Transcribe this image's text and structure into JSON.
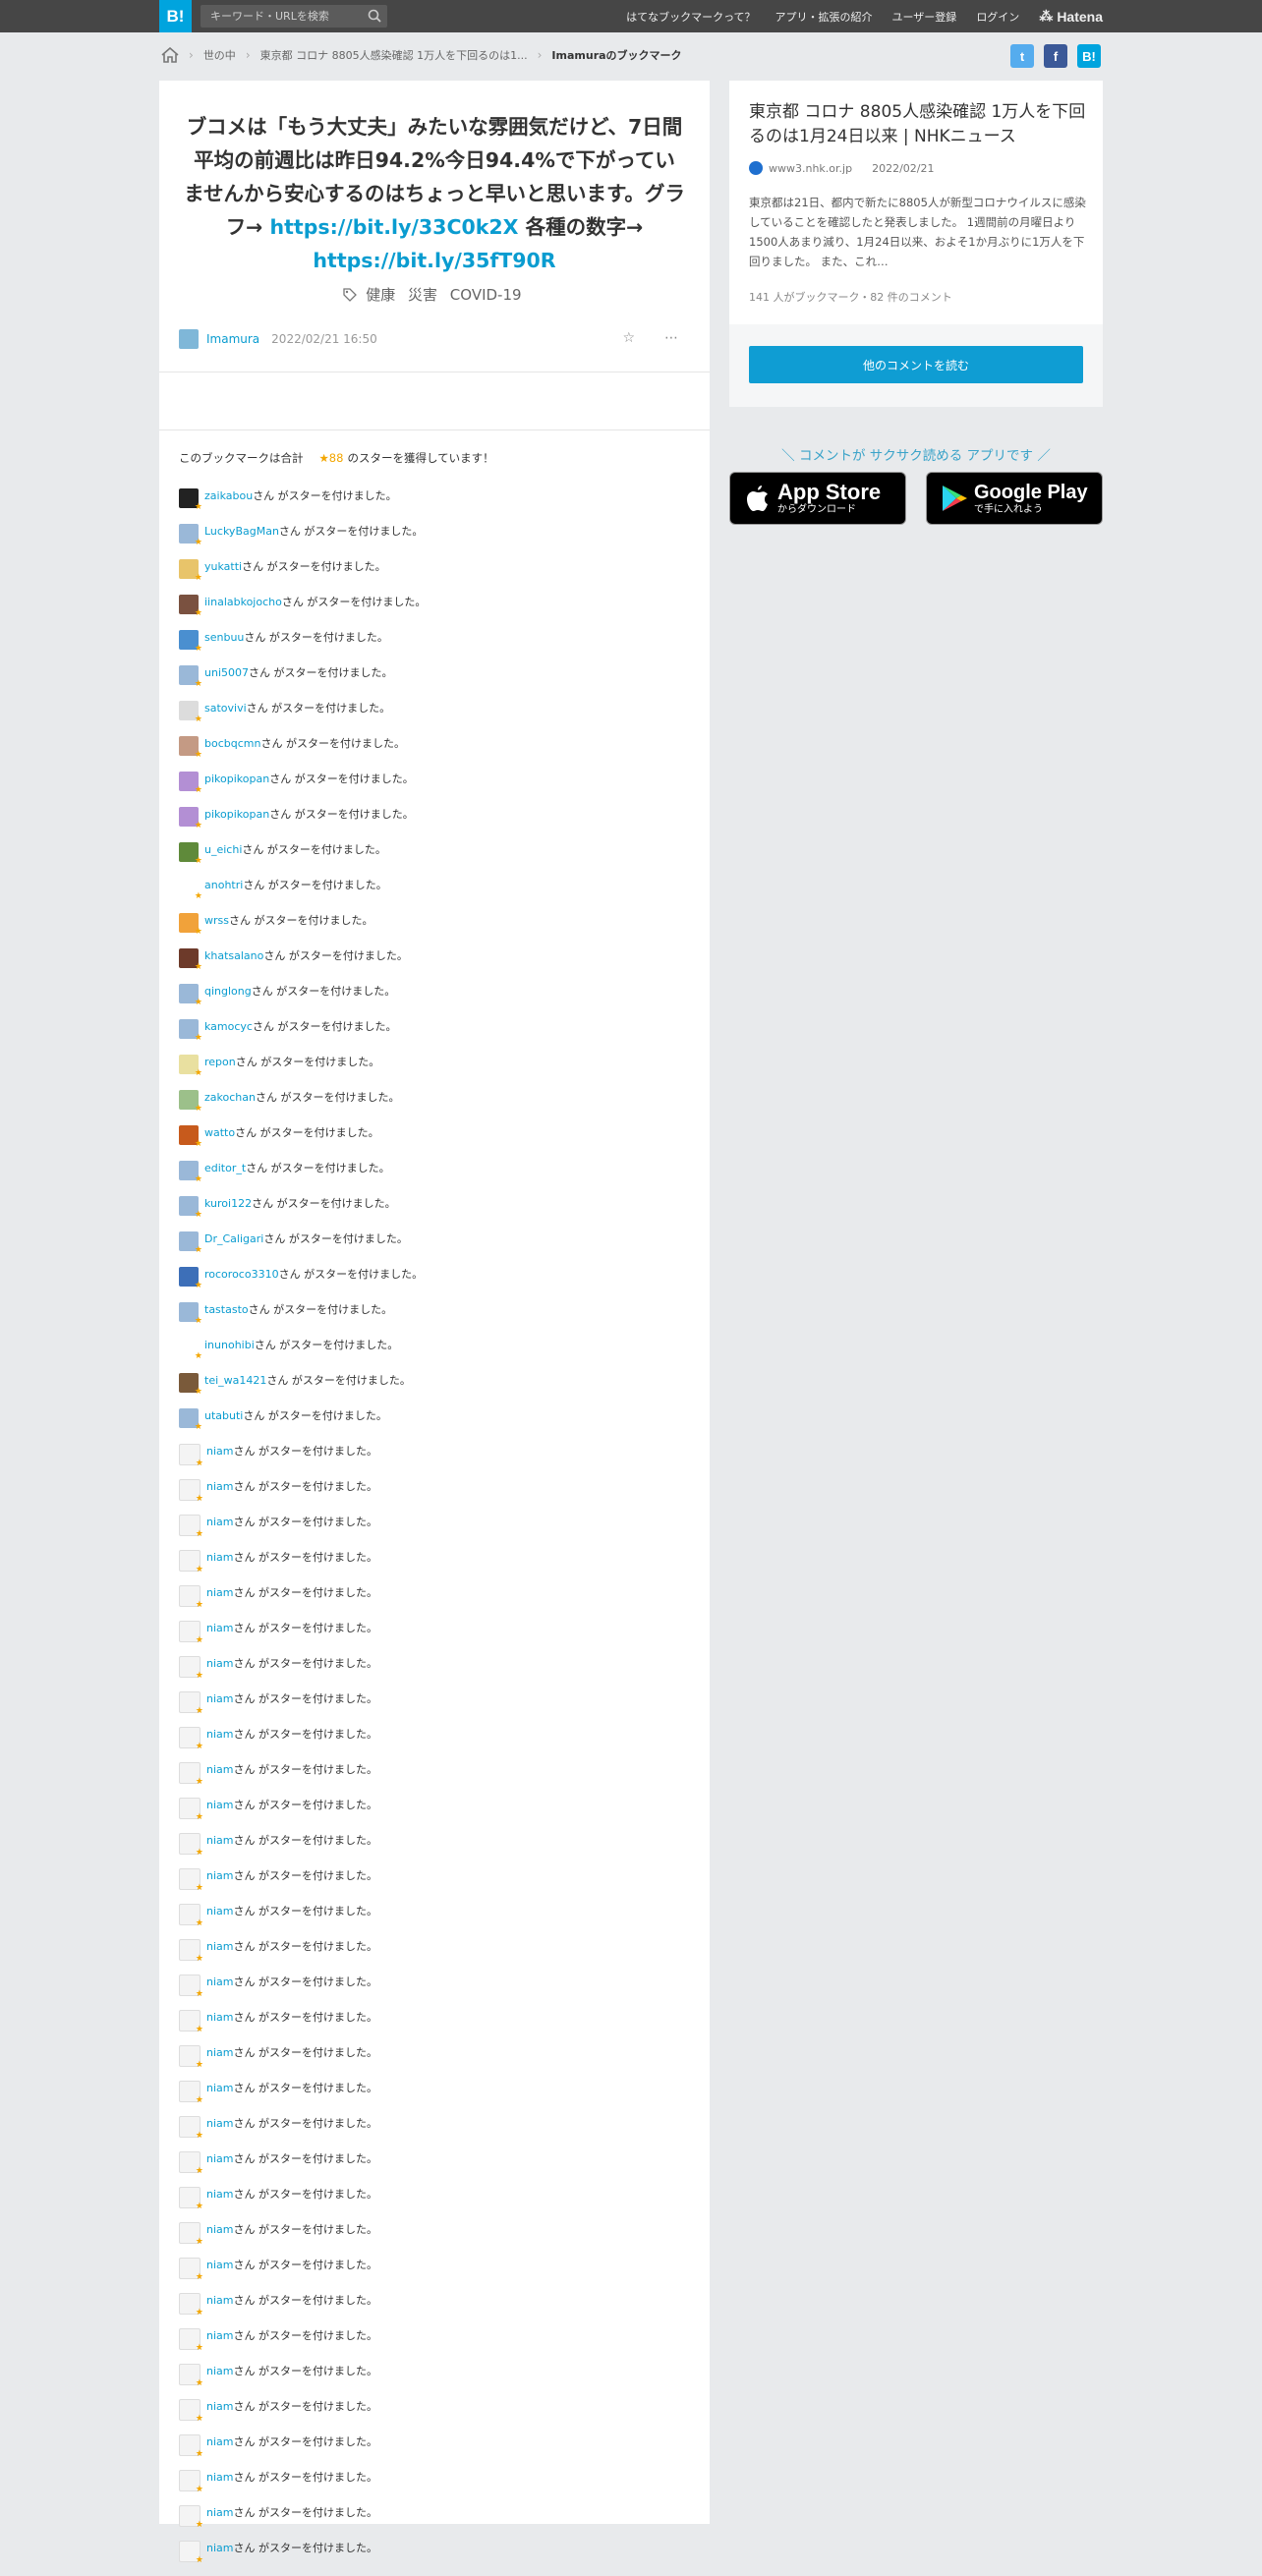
{
  "topbar": {
    "logo": "B!",
    "search_placeholder": "キーワード・URLを検索",
    "links": [
      "はてなブックマークって？",
      "アプリ・拡張の紹介",
      "ユーザー登録",
      "ログイン"
    ],
    "brand": "Hatena"
  },
  "breadcrumb": {
    "items": [
      "世の中",
      "東京都 コロナ 8805人感染確認 1万人を下回るのは1...",
      "Imamuraのブックマーク"
    ]
  },
  "share": {
    "twitter": "t",
    "facebook": "f",
    "hatena": "B!"
  },
  "bookmark": {
    "comment_text": "ブコメは「もう大丈夫」みたいな雰囲気だけど、7日間平均の前週比は昨日94.2%今日94.4%で下がっていませんから安心するのはちょっと早いと思います。グラフ→ ",
    "link1": "https://bit.ly/33C0k2X",
    "mid_text": " 各種の数字→ ",
    "link2": "https://bit.ly/35fT90R",
    "tags": [
      "健康",
      "災害",
      "COVID-19"
    ],
    "user": "Imamura",
    "date": "2022/02/21 16:50"
  },
  "stars": {
    "summary_prefix": "このブックマークは合計",
    "count": "★88",
    "summary_suffix": "のスターを獲得しています！",
    "suffix": "さん がスターを付けました。",
    "users": [
      "zaikabou",
      "LuckyBagMan",
      "yukatti",
      "iinalabkojocho",
      "senbuu",
      "uni5007",
      "satovivi",
      "bocbqcmn",
      "pikopikopan",
      "pikopikopan",
      "u_eichi",
      "anohtri",
      "wrss",
      "khatsalano",
      "qinglong",
      "kamocyc",
      "repon",
      "zakochan",
      "watto",
      "editor_t",
      "kuroi122",
      "Dr_Caligari",
      "rocoroco3310",
      "tastasto",
      "inunohibi",
      "tei_wa1421",
      "utabuti",
      "niam",
      "niam",
      "niam",
      "niam",
      "niam",
      "niam",
      "niam",
      "niam",
      "niam",
      "niam",
      "niam",
      "niam",
      "niam",
      "niam",
      "niam",
      "niam",
      "niam",
      "niam",
      "niam",
      "niam",
      "niam",
      "niam",
      "niam",
      "niam",
      "niam",
      "niam",
      "niam",
      "niam",
      "niam",
      "niam",
      "niam",
      "niam"
    ],
    "avatar_colors": [
      "#222",
      "#9ab8d8",
      "#e8c46a",
      "#7a5140",
      "#4a8fd0",
      "#9ab8d8",
      "#dcdcdc",
      "#c49a84",
      "#b38fd4",
      "#b38fd4",
      "#5f8a3a",
      "#fff",
      "#f1a23a",
      "#6d3a2a",
      "#9ab8d8",
      "#9ab8d8",
      "#e9e0a0",
      "#9cc08a",
      "#c75a1c",
      "#9ab8d8",
      "#9ab8d8",
      "#9ab8d8",
      "#3d6fb8",
      "#9ab8d8",
      "#fff",
      "#7a5a3a",
      "#9ab8d8"
    ]
  },
  "article": {
    "title": "東京都 コロナ 8805人感染確認 1万人を下回るのは1月24日以来 | NHKニュース",
    "domain": "www3.nhk.or.jp",
    "date": "2022/02/21",
    "description": "東京都は21日、都内で新たに8805人が新型コロナウイルスに感染していることを確認したと発表しました。 1週間前の月曜日より1500人あまり減り、1月24日以来、およそ1か月ぶりに1万人を下回りました。 また、これ…",
    "counts": "141 人がブックマーク・82 件のコメント",
    "more_button": "他のコメントを読む"
  },
  "promo": {
    "text": "＼ コメントが サクサク読める アプリです ／",
    "appstore_title": "App Store",
    "appstore_sub": "からダウンロード",
    "googleplay_title": "Google Play",
    "googleplay_sub": "で手に入れよう"
  }
}
